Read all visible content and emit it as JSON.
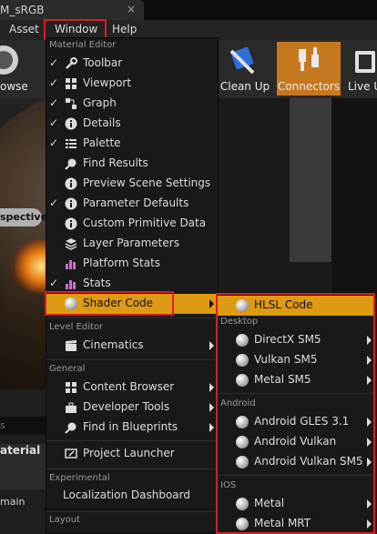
{
  "window_tab": {
    "title": "M_sRGB",
    "close_glyph": "×"
  },
  "menubar": {
    "asset": "Asset",
    "window": "Window",
    "help": "Help"
  },
  "toolbar": {
    "browse": "owse",
    "clean_up": "Clean Up",
    "connectors": "Connectors",
    "live": "Live U"
  },
  "viewport": {
    "perspective": "spective"
  },
  "details": {
    "search_placeholder": "s",
    "section": "aterial",
    "domain": "main"
  },
  "window_menu": {
    "sections": {
      "material_editor": "Material Editor",
      "level_editor": "Level Editor",
      "general": "General",
      "experimental": "Experimental",
      "layout": "Layout"
    },
    "items": {
      "toolbar": "Toolbar",
      "viewport": "Viewport",
      "graph": "Graph",
      "details": "Details",
      "palette": "Palette",
      "find_results": "Find Results",
      "preview_scene": "Preview Scene Settings",
      "parameter_defaults": "Parameter Defaults",
      "custom_primitive": "Custom Primitive Data",
      "layer_parameters": "Layer Parameters",
      "platform_stats": "Platform Stats",
      "stats": "Stats",
      "shader_code": "Shader Code",
      "cinematics": "Cinematics",
      "content_browser": "Content Browser",
      "developer_tools": "Developer Tools",
      "find_in_blueprints": "Find in Blueprints",
      "project_launcher": "Project Launcher",
      "localization_dashboard": "Localization Dashboard"
    },
    "check": "✓"
  },
  "shader_submenu": {
    "hlsl": "HLSL Code",
    "desktop_header": "Desktop",
    "directx": "DirectX SM5",
    "vulkan": "Vulkan SM5",
    "metal_sm5": "Metal SM5",
    "android_header": "Android",
    "gles": "Android GLES 3.1",
    "android_vulkan": "Android Vulkan",
    "android_vulkan_sm5": "Android Vulkan SM5",
    "ios_header": "IOS",
    "metal": "Metal",
    "metal_mrt": "Metal MRT"
  },
  "colors": {
    "highlight": "#dd9a12",
    "annotation_red": "#d91e1e",
    "connectors_active": "#c6781e"
  }
}
